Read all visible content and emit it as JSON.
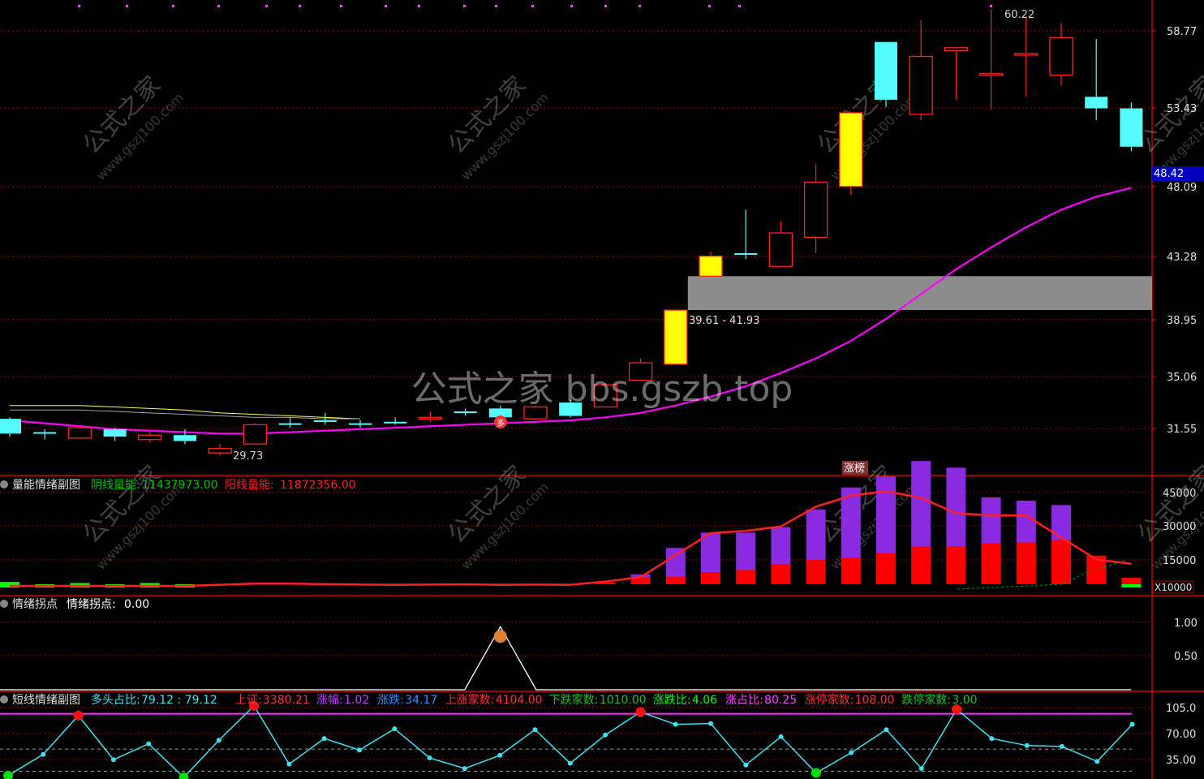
{
  "colors": {
    "up": "#ff2020",
    "down": "#54fcfc",
    "limit_up": "#ffff00",
    "ma": "#ff00ff",
    "ma_yellow": "#ffff40",
    "ma_gray": "#a0a0a0",
    "axis": "#ff0000",
    "grid": "#a00000",
    "label": "#e0e0e0",
    "gray_band": "#8c8c8c",
    "vol_green": "#00ff00",
    "vol_red": "#ff0000",
    "vol_purple": "#8a2be2",
    "cyan_line": "#40e0f0",
    "magenta_line": "#ff30ff"
  },
  "watermark": {
    "center": "公式之家 bbs.gszb.top",
    "tile_cn": "公式之家",
    "tile_url": "www.gszj100.com"
  },
  "main_panel": {
    "y_ticks": [
      "58.77",
      "53.43",
      "48.09",
      "43.28",
      "38.95",
      "35.06",
      "31.55"
    ],
    "current_price": "48.42",
    "high_annotation": "60.22",
    "low_annotation": "29.73",
    "zone_label": "39.61 - 41.93",
    "zt_badge": "涨榜",
    "signal_badge": "多"
  },
  "volume_panel": {
    "title": "量能情绪副图",
    "yin_label": "阴线量能:",
    "yin_value": "11437973.00",
    "yang_label": "阳线量能:",
    "yang_value": "11872356.00",
    "y_ticks": [
      "45000",
      "30000",
      "15000"
    ],
    "unit": "X10000"
  },
  "turn_panel": {
    "title": "情绪拐点",
    "label": "情绪拐点:",
    "value": "0.00",
    "y_ticks": [
      "1.00",
      "0.50"
    ]
  },
  "short_panel": {
    "title": "短线情绪副图",
    "items": [
      {
        "label": "多头占比:",
        "value": "79.12 : 79.12",
        "color": "#40e0f0"
      },
      {
        "label": "上证:",
        "value": "3380.21",
        "color": "#ff3030"
      },
      {
        "label": "涨幅:",
        "value": "1.02",
        "color": "#c040ff"
      },
      {
        "label": "涨跌:",
        "value": "34.17",
        "color": "#3090ff"
      },
      {
        "label": "上涨家数:",
        "value": "4104.00",
        "color": "#ff3030"
      },
      {
        "label": "下跌家数:",
        "value": "1010.00",
        "color": "#20c020"
      },
      {
        "label": "涨跌比:",
        "value": "4.06",
        "color": "#00ff00"
      },
      {
        "label": "涨占比:",
        "value": "80.25",
        "color": "#ff40ff"
      },
      {
        "label": "涨停家数:",
        "value": "108.00",
        "color": "#ff3030"
      },
      {
        "label": "跌停家数:",
        "value": "3.00",
        "color": "#20c020"
      }
    ],
    "y_ticks": [
      "105.0",
      "70.00",
      "35.00"
    ]
  },
  "chart_data": [
    {
      "type": "candlestick",
      "candles": [
        {
          "o": 31.2,
          "h": 32.3,
          "l": 31.0,
          "c": 32.2,
          "s": "down"
        },
        {
          "o": 31.3,
          "h": 31.5,
          "l": 30.8,
          "c": 31.2,
          "s": "down"
        },
        {
          "o": 30.9,
          "h": 31.7,
          "l": 30.9,
          "c": 31.6,
          "s": "up"
        },
        {
          "o": 31.5,
          "h": 31.6,
          "l": 30.7,
          "c": 31.0,
          "s": "down"
        },
        {
          "o": 30.8,
          "h": 31.3,
          "l": 30.6,
          "c": 31.1,
          "s": "up"
        },
        {
          "o": 31.1,
          "h": 31.5,
          "l": 30.5,
          "c": 30.7,
          "s": "down"
        },
        {
          "o": 29.9,
          "h": 30.5,
          "l": 29.73,
          "c": 30.2,
          "s": "up"
        },
        {
          "o": 30.5,
          "h": 31.9,
          "l": 30.5,
          "c": 31.8,
          "s": "up"
        },
        {
          "o": 31.9,
          "h": 32.3,
          "l": 31.6,
          "c": 31.8,
          "s": "down"
        },
        {
          "o": 32.1,
          "h": 32.6,
          "l": 31.8,
          "c": 32.0,
          "s": "down"
        },
        {
          "o": 31.9,
          "h": 32.1,
          "l": 31.6,
          "c": 31.9,
          "s": "down"
        },
        {
          "o": 32.0,
          "h": 32.3,
          "l": 31.8,
          "c": 32.0,
          "s": "down"
        },
        {
          "o": 32.2,
          "h": 32.7,
          "l": 32.0,
          "c": 32.3,
          "s": "up"
        },
        {
          "o": 32.7,
          "h": 32.9,
          "l": 32.4,
          "c": 32.7,
          "s": "down"
        },
        {
          "o": 32.9,
          "h": 33.1,
          "l": 32.3,
          "c": 32.3,
          "s": "down"
        },
        {
          "o": 32.2,
          "h": 33.1,
          "l": 32.2,
          "c": 33.0,
          "s": "up"
        },
        {
          "o": 33.3,
          "h": 33.5,
          "l": 32.3,
          "c": 32.4,
          "s": "down"
        },
        {
          "o": 33.0,
          "h": 34.6,
          "l": 33.0,
          "c": 34.5,
          "s": "up"
        },
        {
          "o": 34.8,
          "h": 36.3,
          "l": 34.8,
          "c": 36.0,
          "s": "up"
        },
        {
          "o": 35.9,
          "h": 39.6,
          "l": 35.9,
          "c": 39.61,
          "s": "limit"
        },
        {
          "o": 41.93,
          "h": 43.6,
          "l": 41.9,
          "c": 43.3,
          "s": "limit"
        },
        {
          "o": 43.5,
          "h": 46.5,
          "l": 43.1,
          "c": 43.5,
          "s": "down"
        },
        {
          "o": 42.6,
          "h": 45.7,
          "l": 42.6,
          "c": 44.9,
          "s": "up"
        },
        {
          "o": 44.6,
          "h": 49.6,
          "l": 43.5,
          "c": 48.4,
          "s": "up"
        },
        {
          "o": 48.1,
          "h": 53.1,
          "l": 47.5,
          "c": 53.1,
          "s": "limit"
        },
        {
          "o": 54.0,
          "h": 58.0,
          "l": 53.5,
          "c": 58.0,
          "s": "down"
        },
        {
          "o": 53.0,
          "h": 59.5,
          "l": 52.6,
          "c": 57.0,
          "s": "up"
        },
        {
          "o": 57.4,
          "h": 57.6,
          "l": 54.0,
          "c": 57.6,
          "s": "up"
        },
        {
          "o": 55.8,
          "h": 60.22,
          "l": 53.3,
          "c": 55.8,
          "s": "up"
        },
        {
          "o": 57.2,
          "h": 59.8,
          "l": 54.2,
          "c": 57.2,
          "s": "up"
        },
        {
          "o": 55.7,
          "h": 59.3,
          "l": 55.0,
          "c": 58.3,
          "s": "up"
        },
        {
          "o": 54.2,
          "h": 58.2,
          "l": 52.6,
          "c": 53.4,
          "s": "down"
        },
        {
          "o": 53.4,
          "h": 53.8,
          "l": 50.5,
          "c": 50.8,
          "s": "down"
        }
      ],
      "ma_magenta": [
        32.1,
        31.9,
        31.7,
        31.5,
        31.4,
        31.3,
        31.2,
        31.2,
        31.3,
        31.4,
        31.5,
        31.6,
        31.7,
        31.8,
        31.9,
        32.0,
        32.1,
        32.3,
        32.6,
        33.1,
        33.7,
        34.4,
        35.3,
        36.3,
        37.5,
        39.0,
        40.7,
        42.4,
        43.9,
        45.3,
        46.5,
        47.4,
        48.0
      ],
      "ma_yellow": [
        33.1,
        33.1,
        33.1,
        33.0,
        32.9,
        32.8,
        32.6,
        32.5,
        32.4,
        32.3,
        32.2
      ],
      "ma_gray": [
        32.8,
        32.8,
        32.8,
        32.7,
        32.6,
        32.5,
        32.4,
        32.3,
        32.3,
        32.2,
        32.2
      ],
      "zone": [
        39.61,
        41.93
      ]
    },
    {
      "type": "bar",
      "name": "量能情绪副图",
      "red": [
        0,
        0,
        0,
        0,
        0,
        0,
        0,
        0,
        0,
        0,
        0,
        0,
        0,
        0,
        0,
        0,
        0,
        1000,
        3000,
        3500,
        5500,
        6500,
        9000,
        11000,
        12000,
        14000,
        17000,
        17000,
        18500,
        19000,
        20000,
        13000,
        3000
      ],
      "purple": [
        0,
        0,
        0,
        0,
        0,
        0,
        0,
        0,
        0,
        0,
        0,
        0,
        0,
        0,
        0,
        0,
        0,
        0,
        1500,
        13000,
        18000,
        17000,
        17000,
        23000,
        32000,
        35000,
        39000,
        36000,
        21000,
        19000,
        16000,
        0,
        0
      ],
      "green": [
        4000,
        3000,
        3500,
        3000,
        3500,
        3000,
        1000,
        0,
        0,
        0,
        0,
        0,
        0,
        0,
        0,
        0,
        0,
        0,
        0,
        0,
        0,
        0,
        0,
        0,
        0,
        0,
        0,
        0,
        0,
        0,
        0,
        0,
        3500
      ],
      "line": [
        0,
        0,
        0,
        0,
        0,
        0,
        500,
        1000,
        1000,
        800,
        600,
        500,
        600,
        700,
        500,
        600,
        500,
        2000,
        4000,
        14000,
        24000,
        25000,
        27000,
        36000,
        41000,
        43000,
        40000,
        33000,
        32000,
        32000,
        22000,
        12000,
        10000
      ],
      "ylim": [
        0,
        45000
      ]
    },
    {
      "type": "line",
      "name": "情绪拐点",
      "peak_index": 14,
      "values_peak": 0.95,
      "ylim": [
        0,
        1.1
      ]
    },
    {
      "type": "line",
      "name": "短线情绪副图",
      "values": [
        22,
        46,
        90,
        40,
        58,
        20,
        62,
        101,
        35,
        64,
        51,
        75,
        42,
        30,
        45,
        74,
        36,
        68,
        94,
        80,
        81,
        34,
        66,
        25,
        48,
        74,
        30,
        97,
        64,
        56,
        55,
        38,
        80
      ],
      "ref_lines": [
        92,
        52,
        27
      ],
      "ylim": [
        20,
        110
      ]
    }
  ]
}
